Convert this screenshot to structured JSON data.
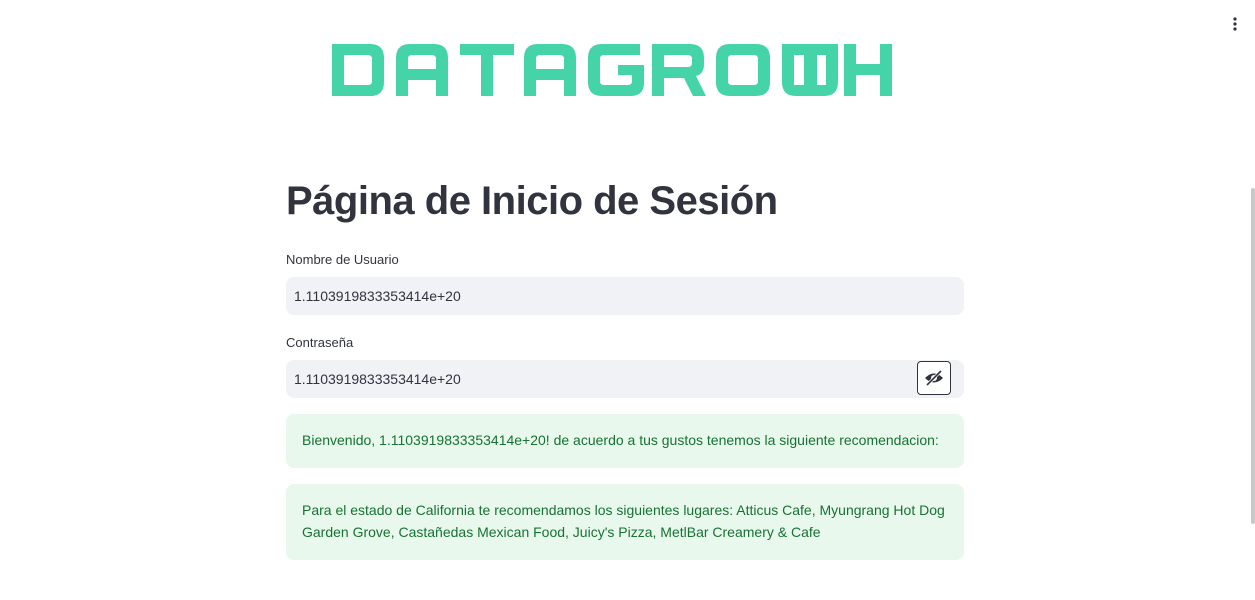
{
  "logo": {
    "text": "DATAGROWTH",
    "color": "#45d3a8"
  },
  "menu": {
    "icon": "vertical-dots-icon"
  },
  "page": {
    "title": "Página de Inicio de Sesión"
  },
  "form": {
    "username": {
      "label": "Nombre de Usuario",
      "value": "1.1103919833353414e+20"
    },
    "password": {
      "label": "Contraseña",
      "value": "1.1103919833353414e+20",
      "toggle_icon": "eye-slash-icon"
    }
  },
  "messages": {
    "welcome": "Bienvenido, 1.1103919833353414e+20! de acuerdo a tus gustos tenemos la siguiente recomendacion:",
    "recommendation": "Para el estado de California te recomendamos los siguientes lugares: Atticus Cafe, Myungrang Hot Dog Garden Grove, Castañedas Mexican Food, Juicy's Pizza, MetlBar Creamery & Cafe"
  },
  "colors": {
    "success_bg": "#e8f8ec",
    "success_text": "#177233",
    "input_bg": "#f0f2f6"
  }
}
